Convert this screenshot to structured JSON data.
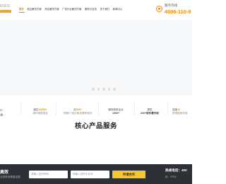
{
  "logo": {
    "text": "RSDS",
    "tagline": "REAL SUCCESS"
  },
  "nav": {
    "items": [
      "首页",
      "政企解决方案",
      "商业解决方案",
      "广告行业解决方案",
      "服务与支持",
      "关于我们",
      "新闻中心"
    ]
  },
  "hotline": {
    "label": "服务热线",
    "number": "4006-110-9"
  },
  "carousel": {
    "dots": 5
  },
  "stats": [
    {
      "line1": "行",
      "line2": "本"
    },
    {
      "line1_prefix": "超过",
      "line1_value": "10000+",
      "line2": "场环境各类会"
    },
    {
      "line1_prefix": "近",
      "line1_value": "500+",
      "line2": "同期门 前针和品牌获相况"
    },
    {
      "line1": "服务政府企业",
      "line1_value": "1000+",
      "line2": ""
    },
    {
      "line1": "提供",
      "line1_value": "200+软件著作权",
      "line2": ""
    },
    {
      "line1_prefix": "连续",
      "line1_value": "12",
      "line2": "获得国家双软"
    }
  ],
  "section": {
    "title": "核心产品服务"
  },
  "footer": {
    "title": "高效",
    "subtitle": "业务体系覆盖全国",
    "name_placeholder": "请输入您的称呼",
    "phone_placeholder": "请输入您的手机号",
    "apply_label": "申请合作",
    "hotline_label": "热线电话：400",
    "hotline_sub": "队：9753-"
  }
}
